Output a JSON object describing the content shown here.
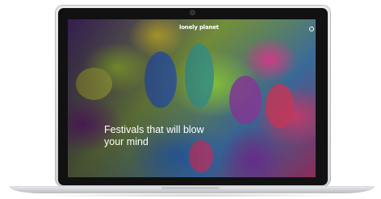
{
  "page": {
    "breadcrumb": "",
    "logo_text": "lonely planet",
    "nav": [],
    "hero": {
      "kicker": "",
      "title": "Festivals that will blow your mind",
      "link": ""
    },
    "cards": []
  },
  "colors": {
    "bezel": "#111111",
    "aluminum": "#d8dadd",
    "title_text": "#ffffff"
  },
  "icons": [
    "search-icon",
    "camera-dot"
  ]
}
